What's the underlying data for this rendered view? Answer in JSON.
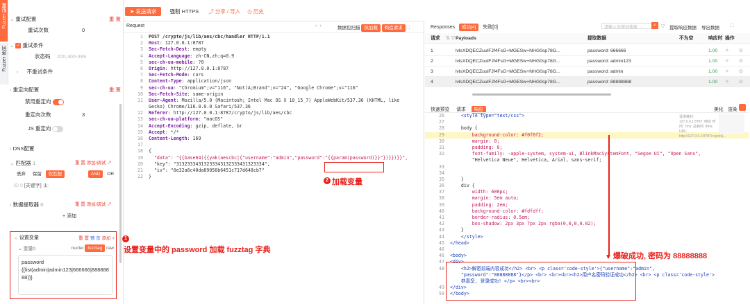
{
  "vtabs": {
    "fuzzer": "Fuzzer 配置",
    "seq": "Fuzzer 序列"
  },
  "left": {
    "retry_title": "重试配置",
    "reset": "重 置",
    "retry_count_label": "重试次数",
    "retry_count": "0",
    "retry_cond": "重试条件",
    "status_label": "状态码",
    "status_ph": "200,300-399",
    "no_retry": "不重试条件",
    "redirect_title": "重定向配置",
    "disable_redirect": "禁用重定向",
    "redirect_count_label": "重定向次数",
    "redirect_count": "3",
    "js_redirect": "JS 重定向",
    "dns_title": "DNS配置",
    "matcher_title": "匹配器",
    "matcher_count": "1",
    "add_rules": "添加/调试 ↗",
    "m_discard": "丢弃",
    "m_keep": "保留",
    "m_color": "仅匹配",
    "m_and": "AND",
    "m_or": "OR",
    "m_id": "ID 0",
    "m_keyword": "[关键字]",
    "m_num": "1",
    "extractor_title": "数据提取器",
    "extractor_count": "0",
    "add": "+ 添加",
    "vars_title": "设置变量",
    "preview": "预 览",
    "add2": "添加 +",
    "var_name": "变量0",
    "vt_nuclei": "nuclei",
    "vt_fuzztag": "fuzztag",
    "vt_raw": "raw",
    "var_key": "password",
    "var_val": "{{list(admin|admin123|666666|88888888)}}"
  },
  "toolbar": {
    "send": "发送请求",
    "https": "强制 HTTPS",
    "share": "分享 / 导入",
    "history": "历史"
  },
  "request": {
    "title": "Request",
    "codec": "数据包扫描",
    "btn1": "热加载",
    "btn2": "构造请求"
  },
  "req_lines": [
    [
      "1",
      "POST /crypto/js/lib/aes/cbc/handler HTTP/1.1"
    ],
    [
      "2",
      "Host: 127.0.0.1:8787"
    ],
    [
      "3",
      "Sec-Fetch-Dest: empty"
    ],
    [
      "4",
      "Accept-Language: zh-CN,zh;q=0.9"
    ],
    [
      "5",
      "sec-ch-ua-mobile: ?0"
    ],
    [
      "6",
      "Origin: http://127.0.0.1:8787"
    ],
    [
      "7",
      "Sec-Fetch-Mode: cors"
    ],
    [
      "8",
      "Content-Type: application/json"
    ],
    [
      "9",
      "sec-ch-ua: \"Chromium\";v=\"116\", \"Not)A;Brand\";v=\"24\", \"Google Chrome\";v=\"116\""
    ],
    [
      "10",
      "Sec-Fetch-Site: same-origin"
    ],
    [
      "11",
      "User-Agent: Mozilla/5.0 (Macintosh; Intel Mac OS X 10_15_7) AppleWebKit/537.36 (KHTML, like"
    ],
    [
      "",
      "Gecko) Chrome/116.0.0.0 Safari/537.36"
    ],
    [
      "12",
      "Referer: http://127.0.0.1:8787/crypto/js/lib/aes/cbc"
    ],
    [
      "13",
      "sec-ch-ua-platform: \"macOS\""
    ],
    [
      "14",
      "Accept-Encoding: gzip, deflate, br"
    ],
    [
      "15",
      "Accept: */*"
    ],
    [
      "16",
      "Content-Length: 169"
    ],
    [
      "17",
      ""
    ],
    [
      "18",
      "{"
    ],
    [
      "19",
      "  \"data\": \"{{base64({{yak(aescbc|{\"username\":\"admin\",\"password\":\"{{param(password)}}\"})}})}}\","
    ],
    [
      "20",
      "  \"key\": \"31323334313233343132333431323334\","
    ],
    [
      "21",
      "  \"iv\": \"0e32a6c40da89058b6451c717d648cb7\""
    ],
    [
      "22",
      "}"
    ]
  ],
  "responses": {
    "title": "Responses",
    "ok_tab": "成功[4]",
    "fail_tab": "失败[0]",
    "search_ph": "请输入关键词搜索",
    "extract": "提取响应数据",
    "export": "导出数据",
    "cols": [
      "请求",
      "",
      "Payloads",
      "提取数据",
      "不为空",
      "响应时",
      "操作"
    ]
  },
  "rows": [
    {
      "id": "1",
      "payload": "lvlsXDQECZuulFJf4FsG+MGESw+NHG0sp78G...",
      "data": "password: 666666",
      "t": "1.00"
    },
    {
      "id": "2",
      "payload": "lvlsXDQECZuulFJf4FsG+MGESw+NHG0sp78G...",
      "data": "password: admin123",
      "t": "1.00"
    },
    {
      "id": "3",
      "payload": "lvlsXDQECZuulFJf4FsG+MGESw+NHG0sp78G...",
      "data": "password: admin",
      "t": "1.00"
    },
    {
      "id": "4",
      "payload": "lvlsXDQECZuulFJf4FsG+MGESw+NHG0sp78G...",
      "data": "password: 88888888",
      "t": "1.00"
    }
  ],
  "preview": {
    "t1": "快速预览",
    "t2": "请求",
    "t3": "响应",
    "beautify": "美化",
    "render": "渲染"
  },
  "resp_lines": [
    [
      "26",
      "    <style type=\"text/css\">"
    ],
    [
      "27",
      ""
    ],
    [
      "28",
      "    body {"
    ],
    [
      "29",
      "        background-color: #f0f0f2;"
    ],
    [
      "30",
      "        margin: 0;"
    ],
    [
      "31",
      "        padding: 0;"
    ],
    [
      "32",
      "        font-family: -apple-system, system-ui, BlinkMacSystemFont, \"Segoe UI\", \"Open Sans\","
    ],
    [
      "",
      "        \"Helvetica Neue\", Helvetica, Arial, sans-serif;"
    ],
    [
      "33",
      ""
    ],
    [
      "34",
      ""
    ],
    [
      "35",
      "    }"
    ],
    [
      "36",
      "    div {"
    ],
    [
      "37",
      "        width: 600px;"
    ],
    [
      "38",
      "        margin: 5em auto;"
    ],
    [
      "39",
      "        padding: 2em;"
    ],
    [
      "40",
      "        background-color: #fdfdff;"
    ],
    [
      "41",
      "        border-radius: 0.5em;"
    ],
    [
      "42",
      "        box-shadow: 2px 3px 7px 2px rgba(0,0,0,0.02);"
    ],
    [
      "43",
      "    }"
    ],
    [
      "44",
      "    </style>"
    ],
    [
      "45",
      "</head>"
    ],
    [
      "46",
      ""
    ],
    [
      "46",
      "<body>"
    ],
    [
      "47",
      "<div>"
    ],
    [
      "48",
      "    <h2>解密前端内容成功</h2> <br> <p class='code-style'>{\"username\":\"admin\","
    ],
    [
      "",
      "    \"password\":\"88888888\"}</p> <br> <br><br><h2>用户名密码验证成功</h2> <br> <p class='code-style'>"
    ],
    [
      "",
      "    恭喜您, 登录成功! </p> <br><br>"
    ],
    [
      "49",
      "</div>"
    ],
    [
      "50",
      "</body>"
    ]
  ],
  "resp_meta": "请求耗时: 127.0.0.1:8787; 响应 时间: 7ms; 总耗时: 8ms; URL: http://127.0.0.1:8787/crypto/j...",
  "annotations": {
    "a1": "设置变量中的 password 加载 fuzztag 字典",
    "a2": "加载变量",
    "a3": "爆破成功, 密码为 88888888",
    "n1": "1",
    "n2": "2"
  }
}
